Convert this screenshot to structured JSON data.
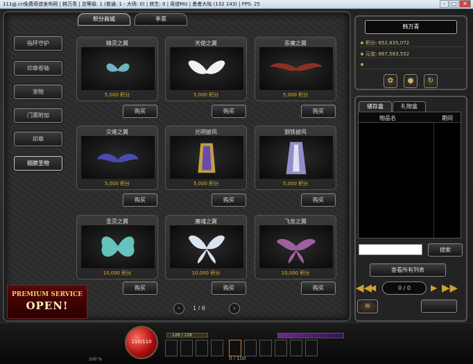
{
  "titlebar": {
    "text": "111gj.cn免费奇迹发布网 | 韩万青 | 总等级: 1 (普通: 1 - 大师: 0) | 转生: 0 | 奇迹MU | 勇者大陆 (132 143) | FPS: 25",
    "min": "–",
    "max": "□",
    "close": "✕"
  },
  "tabs": [
    "积分商城",
    "季票"
  ],
  "left_menu": [
    "指环守护",
    "印章卷轴",
    "宠物",
    "门票附加",
    "印章",
    "翅膀圣物"
  ],
  "items": [
    {
      "name": "精灵之翼",
      "price": "5,000 积分",
      "buy": "购买",
      "color": "#7fd8e8"
    },
    {
      "name": "天使之翼",
      "price": "5,000 积分",
      "buy": "购买",
      "color": "#f0f0f0"
    },
    {
      "name": "恶魔之翼",
      "price": "5,000 积分",
      "buy": "购买",
      "color": "#8a3020"
    },
    {
      "name": "灾难之翼",
      "price": "5,000 积分",
      "buy": "购买",
      "color": "#4a4ab0"
    },
    {
      "name": "光明披风",
      "price": "5,000 积分",
      "buy": "购买",
      "color": "#c0a040"
    },
    {
      "name": "钢铁披风",
      "price": "5,000 积分",
      "buy": "购买",
      "color": "#9090c8"
    },
    {
      "name": "圣灵之翼",
      "price": "10,000 积分",
      "buy": "购买",
      "color": "#70e0d8"
    },
    {
      "name": "魔魂之翼",
      "price": "10,000 积分",
      "buy": "购买",
      "color": "#d8e4f0"
    },
    {
      "name": "飞龙之翼",
      "price": "10,000 积分",
      "buy": "购买",
      "color": "#a060a0"
    }
  ],
  "pager": {
    "text": "1 / 6",
    "prev": "‹",
    "next": "›"
  },
  "premium": {
    "line1": "PREMIUM SERVICE",
    "line2": "OPEN!"
  },
  "player": {
    "name": "韩万青",
    "points": "积分: 652,835,072",
    "yuanbao": "元宝: 867,583,552",
    "icon1": "gift-icon",
    "icon2": "coins-icon",
    "icon3": "refresh-icon"
  },
  "storage": {
    "tab_storage": "储存盒",
    "tab_gift": "礼物盒",
    "col_item": "物品名",
    "col_period": "期间",
    "search_value": "",
    "search_btn": "搜索",
    "view_all": "查看所有列表",
    "page": "0 / 0",
    "first": "◀◀",
    "prev": "◀",
    "next": "▶",
    "last": "▶▶"
  },
  "hud": {
    "hp": "110/110",
    "xp": "128 / 128",
    "bag": "0 / 100",
    "pct": "100 %",
    "slot_labels": [
      "Q",
      "W",
      "E",
      "R"
    ]
  }
}
